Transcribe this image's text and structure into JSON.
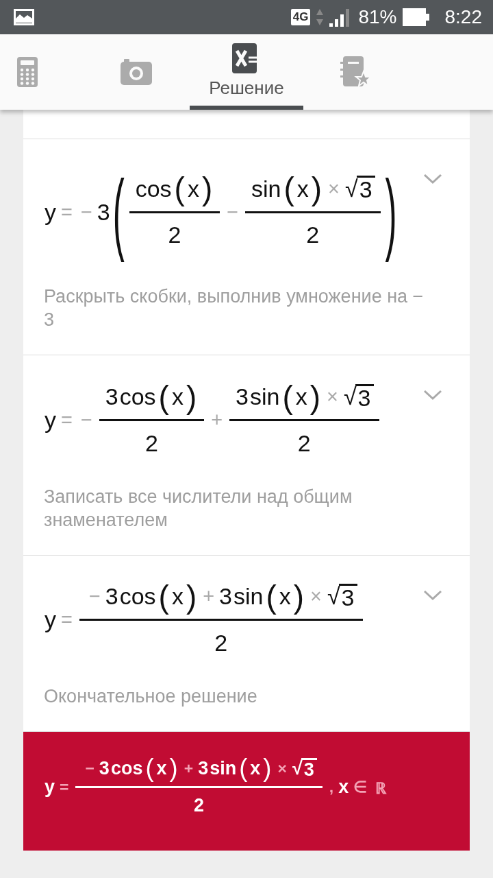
{
  "status_bar": {
    "network": "4G",
    "battery": "81%",
    "time": "8:22"
  },
  "tabs": [
    {
      "selected": false
    },
    {
      "selected": false
    },
    {
      "label": "Решение",
      "selected": true
    },
    {
      "selected": false
    }
  ],
  "steps": [
    {
      "kind": "step",
      "expanded": false,
      "formula": [
        {
          "kind": "sym",
          "text": "y"
        },
        {
          "kind": "op",
          "text": "="
        },
        {
          "kind": "op",
          "text": "−"
        },
        {
          "kind": "sym",
          "text": "3"
        },
        {
          "kind": "group",
          "open": "(",
          "close": ")",
          "body": [
            {
              "kind": "frac",
              "num": [
                {
                  "kind": "sym",
                  "text": "cos"
                },
                {
                  "kind": "group",
                  "open": "(",
                  "close": ")",
                  "body": [
                    {
                      "kind": "sym",
                      "text": "x"
                    }
                  ]
                }
              ],
              "den": [
                {
                  "kind": "sym",
                  "text": "2"
                }
              ]
            },
            {
              "kind": "op",
              "text": "−"
            },
            {
              "kind": "frac",
              "num": [
                {
                  "kind": "sym",
                  "text": "sin"
                },
                {
                  "kind": "group",
                  "open": "(",
                  "close": ")",
                  "body": [
                    {
                      "kind": "sym",
                      "text": "x"
                    }
                  ]
                },
                {
                  "kind": "op",
                  "text": "×"
                },
                {
                  "kind": "sqrt",
                  "sign": "√",
                  "body": [
                    {
                      "kind": "sym",
                      "text": "3"
                    }
                  ]
                }
              ],
              "den": [
                {
                  "kind": "sym",
                  "text": "2"
                }
              ]
            }
          ]
        }
      ],
      "description": "Раскрыть скобки, выполнив умножение на − 3"
    },
    {
      "kind": "step",
      "expanded": false,
      "formula": [
        {
          "kind": "sym",
          "text": "y"
        },
        {
          "kind": "op",
          "text": "="
        },
        {
          "kind": "op",
          "text": "−"
        },
        {
          "kind": "frac",
          "num": [
            {
              "kind": "sym",
              "text": "3"
            },
            {
              "kind": "sym",
              "text": "cos"
            },
            {
              "kind": "group",
              "open": "(",
              "close": ")",
              "body": [
                {
                  "kind": "sym",
                  "text": "x"
                }
              ]
            }
          ],
          "den": [
            {
              "kind": "sym",
              "text": "2"
            }
          ]
        },
        {
          "kind": "op",
          "text": "+"
        },
        {
          "kind": "frac",
          "num": [
            {
              "kind": "sym",
              "text": "3"
            },
            {
              "kind": "sym",
              "text": "sin"
            },
            {
              "kind": "group",
              "open": "(",
              "close": ")",
              "body": [
                {
                  "kind": "sym",
                  "text": "x"
                }
              ]
            },
            {
              "kind": "op",
              "text": "×"
            },
            {
              "kind": "sqrt",
              "sign": "√",
              "body": [
                {
                  "kind": "sym",
                  "text": "3"
                }
              ]
            }
          ],
          "den": [
            {
              "kind": "sym",
              "text": "2"
            }
          ]
        }
      ],
      "description": "Записать все числители над общим знаменателем"
    },
    {
      "kind": "step",
      "expanded": false,
      "formula": [
        {
          "kind": "sym",
          "text": "y"
        },
        {
          "kind": "op",
          "text": "="
        },
        {
          "kind": "frac",
          "num": [
            {
              "kind": "op",
              "text": "−"
            },
            {
              "kind": "sym",
              "text": "3"
            },
            {
              "kind": "sym",
              "text": "cos"
            },
            {
              "kind": "group",
              "open": "(",
              "close": ")",
              "body": [
                {
                  "kind": "sym",
                  "text": "x"
                }
              ]
            },
            {
              "kind": "op",
              "text": "+"
            },
            {
              "kind": "sym",
              "text": "3"
            },
            {
              "kind": "sym",
              "text": "sin"
            },
            {
              "kind": "group",
              "open": "(",
              "close": ")",
              "body": [
                {
                  "kind": "sym",
                  "text": "x"
                }
              ]
            },
            {
              "kind": "op",
              "text": "×"
            },
            {
              "kind": "sqrt",
              "sign": "√",
              "body": [
                {
                  "kind": "sym",
                  "text": "3"
                }
              ]
            }
          ],
          "den": [
            {
              "kind": "sym",
              "text": "2"
            }
          ]
        }
      ],
      "description": "Окончательное решение"
    },
    {
      "kind": "answer",
      "formula": [
        {
          "kind": "sym",
          "text": "y"
        },
        {
          "kind": "op",
          "text": "="
        },
        {
          "kind": "frac",
          "num": [
            {
              "kind": "op",
              "text": "−"
            },
            {
              "kind": "sym",
              "text": "3"
            },
            {
              "kind": "sym",
              "text": "cos"
            },
            {
              "kind": "group",
              "open": "(",
              "close": ")",
              "body": [
                {
                  "kind": "sym",
                  "text": "x"
                }
              ]
            },
            {
              "kind": "op",
              "text": "+"
            },
            {
              "kind": "sym",
              "text": "3"
            },
            {
              "kind": "sym",
              "text": "sin"
            },
            {
              "kind": "group",
              "open": "(",
              "close": ")",
              "body": [
                {
                  "kind": "sym",
                  "text": "x"
                }
              ]
            },
            {
              "kind": "op",
              "text": "×"
            },
            {
              "kind": "sqrt",
              "sign": "√",
              "body": [
                {
                  "kind": "sym",
                  "text": "3"
                }
              ]
            }
          ],
          "den": [
            {
              "kind": "sym",
              "text": "2"
            }
          ]
        },
        {
          "kind": "op",
          "text": ","
        },
        {
          "kind": "sym",
          "text": "x"
        },
        {
          "kind": "op",
          "text": "∈"
        },
        {
          "kind": "op",
          "text": "ℝ"
        }
      ]
    }
  ]
}
